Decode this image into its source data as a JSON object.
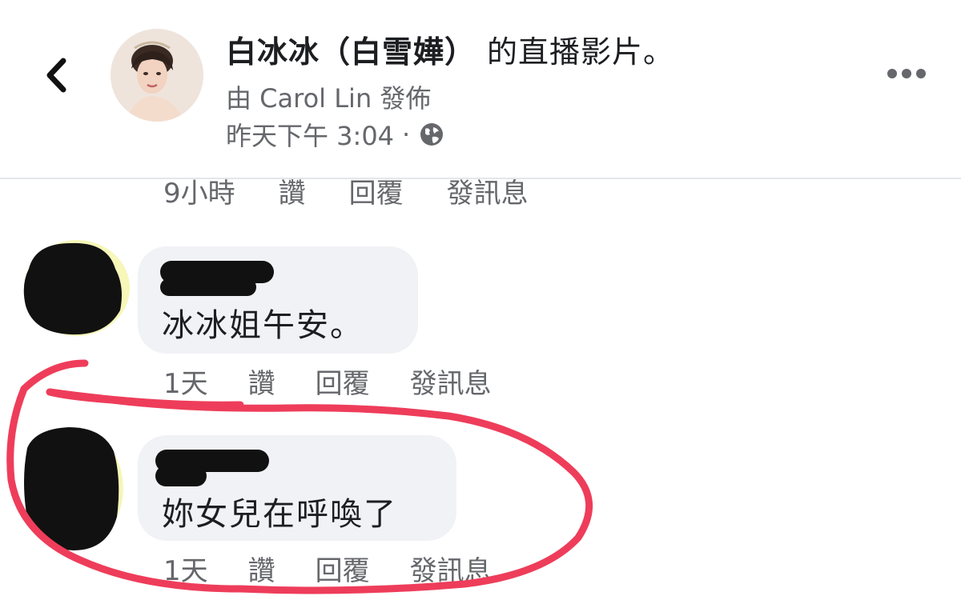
{
  "header": {
    "back_icon": "chevron-left-icon",
    "title": "白冰冰（白雪嬅）",
    "title_suffix": "的直播影片。",
    "subtitle": "由 Carol Lin 發佈",
    "timestamp": "昨天下午 3:04",
    "separator": "·",
    "privacy_icon": "globe-icon",
    "more_icon": "more-horizontal-icon"
  },
  "previous_comment": {
    "time": "9小時",
    "like_label": "讚",
    "reply_label": "回覆",
    "message_label": "發訊息"
  },
  "comments": [
    {
      "text": "冰冰姐午安。",
      "time": "1天",
      "like_label": "讚",
      "reply_label": "回覆",
      "message_label": "發訊息"
    },
    {
      "text": "妳女兒在呼喚了",
      "time": "1天",
      "like_label": "讚",
      "reply_label": "回覆",
      "message_label": "發訊息"
    }
  ],
  "colors": {
    "annotation": "#ee3d5a",
    "bubble": "#f0f2f5",
    "secondary_text": "#65676b",
    "primary_text": "#1c1e21",
    "redaction": "#111111"
  }
}
